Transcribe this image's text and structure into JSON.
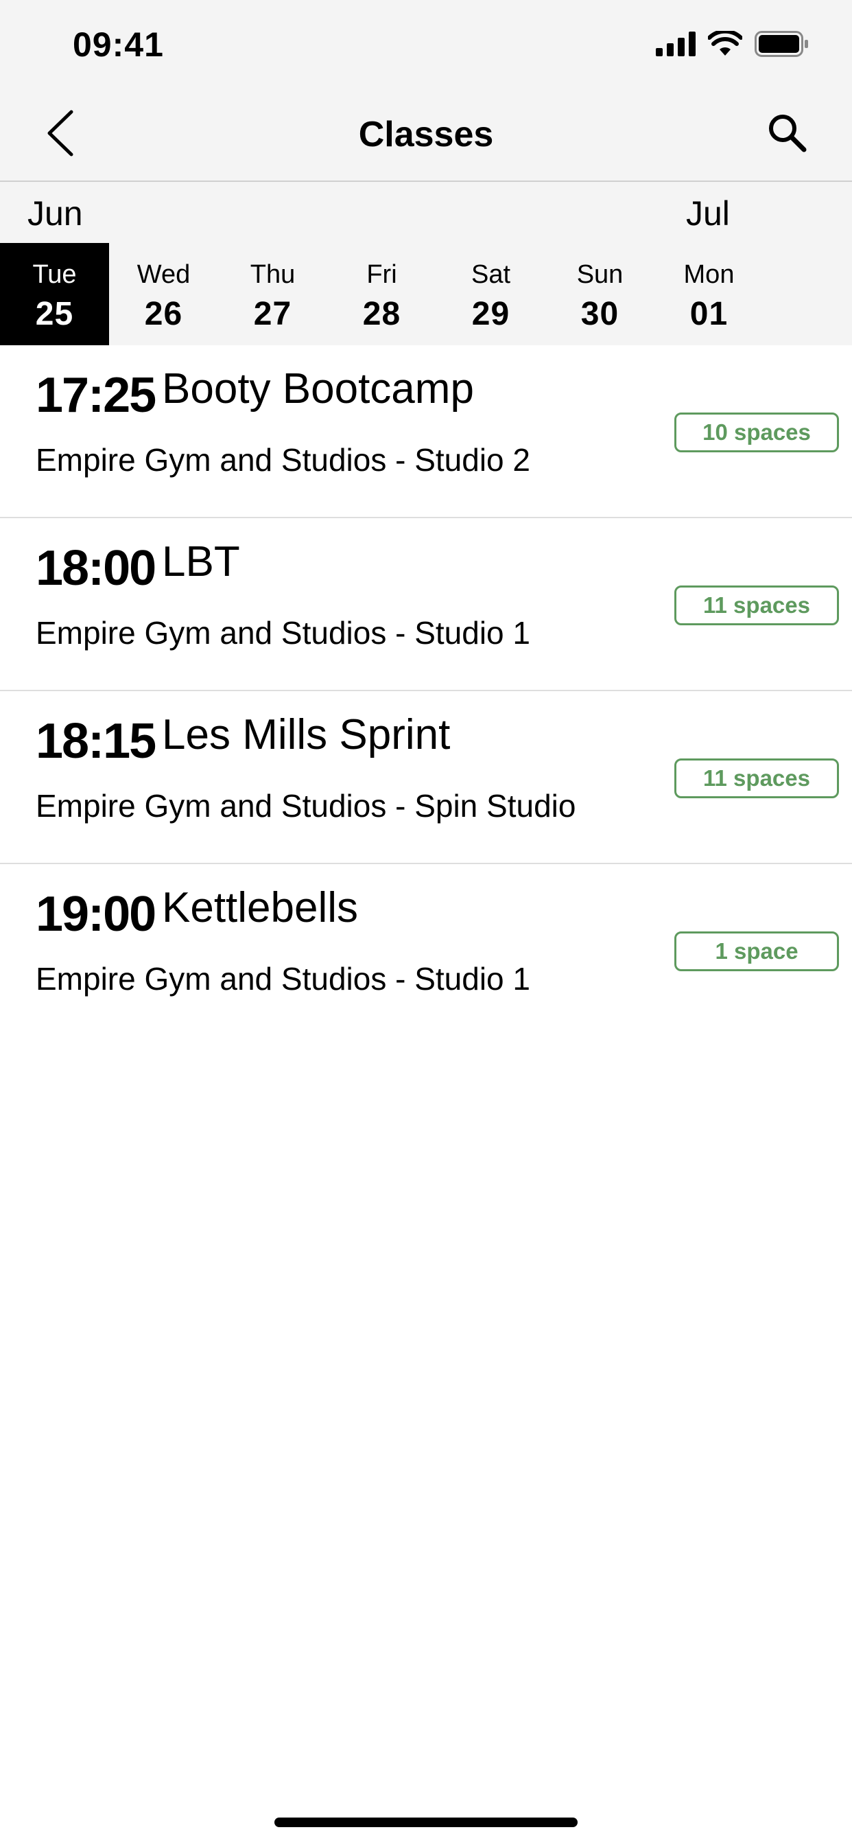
{
  "status_bar": {
    "time": "09:41"
  },
  "nav": {
    "title": "Classes"
  },
  "calendar": {
    "months": [
      "Jun",
      "Jul"
    ],
    "days": [
      {
        "name": "Tue",
        "num": "25"
      },
      {
        "name": "Wed",
        "num": "26"
      },
      {
        "name": "Thu",
        "num": "27"
      },
      {
        "name": "Fri",
        "num": "28"
      },
      {
        "name": "Sat",
        "num": "29"
      },
      {
        "name": "Sun",
        "num": "30"
      },
      {
        "name": "Mon",
        "num": "01"
      }
    ],
    "selected_day": "Tue 25"
  },
  "classes": [
    {
      "time": "17:25",
      "name": "Booty Bootcamp",
      "location": "Empire Gym and Studios - Studio 2",
      "spaces": "10 spaces"
    },
    {
      "time": "18:00",
      "name": "LBT",
      "location": "Empire Gym and Studios - Studio 1",
      "spaces": "11 spaces"
    },
    {
      "time": "18:15",
      "name": "Les Mills Sprint",
      "location": "Empire Gym and Studios - Spin Studio",
      "spaces": "11 spaces"
    },
    {
      "time": "19:00",
      "name": "Kettlebells",
      "location": "Empire Gym and Studios - Studio 1",
      "spaces": "1 space"
    }
  ],
  "colors": {
    "accent_green": "#5e9a5e",
    "selected_day_bg": "#000000",
    "header_bg": "#f4f4f4"
  },
  "icons": [
    "back-chevron-icon",
    "search-icon",
    "signal-icon",
    "wifi-icon",
    "battery-icon"
  ]
}
